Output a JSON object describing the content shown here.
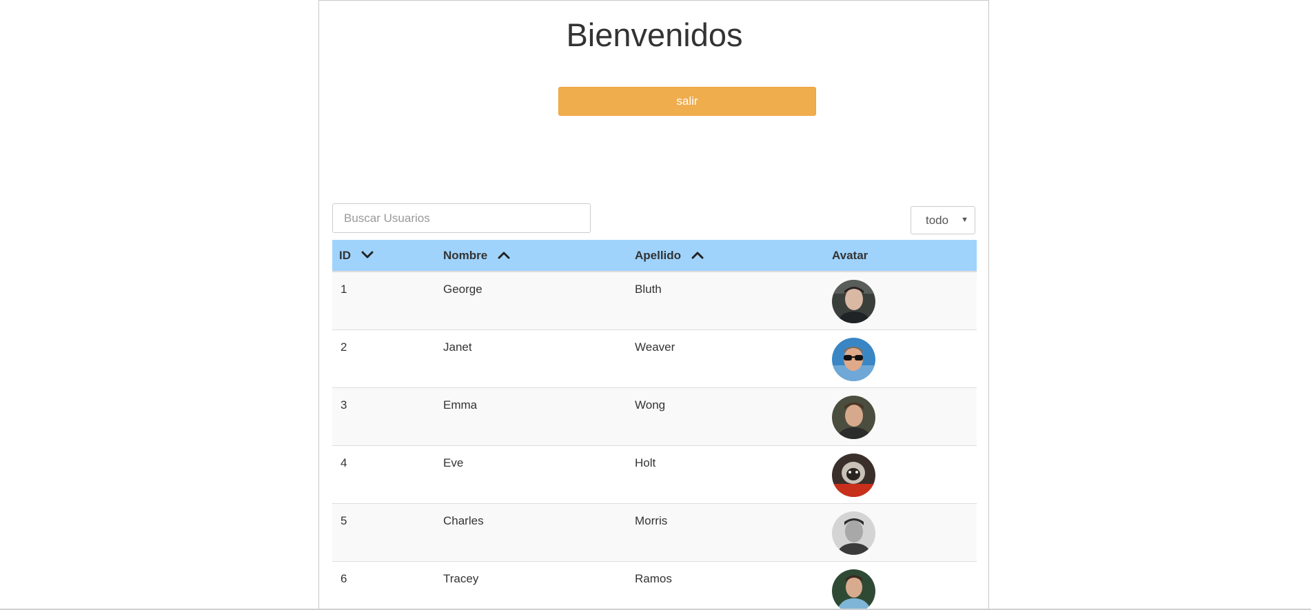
{
  "header": {
    "title": "Bienvenidos",
    "logout_label": "salir"
  },
  "search": {
    "placeholder": "Buscar Usuarios",
    "value": ""
  },
  "filter": {
    "selected": "todo"
  },
  "table": {
    "columns": [
      {
        "label": "ID",
        "sort": "desc"
      },
      {
        "label": "Nombre",
        "sort": "asc"
      },
      {
        "label": "Apellido",
        "sort": "asc"
      },
      {
        "label": "Avatar",
        "sort": "none"
      }
    ],
    "rows": [
      {
        "id": "1",
        "first_name": "George",
        "last_name": "Bluth",
        "avatar": "avatar-photo-1"
      },
      {
        "id": "2",
        "first_name": "Janet",
        "last_name": "Weaver",
        "avatar": "avatar-photo-2"
      },
      {
        "id": "3",
        "first_name": "Emma",
        "last_name": "Wong",
        "avatar": "avatar-photo-3"
      },
      {
        "id": "4",
        "first_name": "Eve",
        "last_name": "Holt",
        "avatar": "avatar-photo-4"
      },
      {
        "id": "5",
        "first_name": "Charles",
        "last_name": "Morris",
        "avatar": "avatar-photo-5"
      },
      {
        "id": "6",
        "first_name": "Tracey",
        "last_name": "Ramos",
        "avatar": "avatar-photo-6"
      }
    ]
  },
  "colors": {
    "accent_button": "#f0ad4e",
    "table_header": "#9fd3fc",
    "row_stripe": "#f9f9f9",
    "border": "#dddddd"
  },
  "icons": {
    "sort_desc": "chevron-down-icon",
    "sort_asc": "chevron-up-icon"
  }
}
